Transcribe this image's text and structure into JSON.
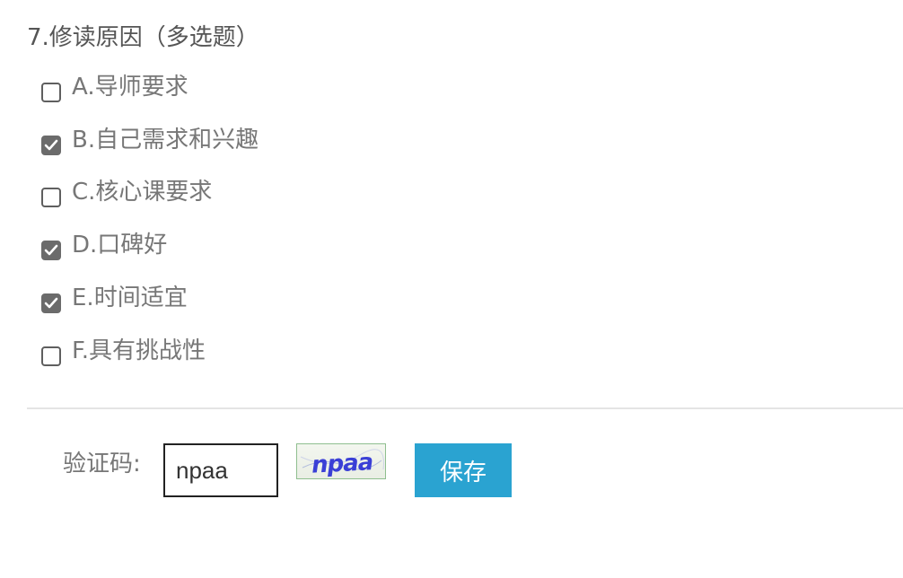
{
  "question": {
    "title": "7.修读原因（多选题）",
    "options": [
      {
        "label": "A.导师要求",
        "checked": false
      },
      {
        "label": "B.自己需求和兴趣",
        "checked": true
      },
      {
        "label": "C.核心课要求",
        "checked": false
      },
      {
        "label": "D.口碑好",
        "checked": true
      },
      {
        "label": "E.时间适宜",
        "checked": true
      },
      {
        "label": "F.具有挑战性",
        "checked": false
      }
    ]
  },
  "captcha": {
    "label": "验证码:",
    "input_value": "npaa",
    "image_text": "npaa"
  },
  "save_label": "保存",
  "colors": {
    "save_button": "#2aa3d1",
    "checkbox_checked": "#6b6b6b",
    "captcha_text": "#3a3fd6"
  }
}
